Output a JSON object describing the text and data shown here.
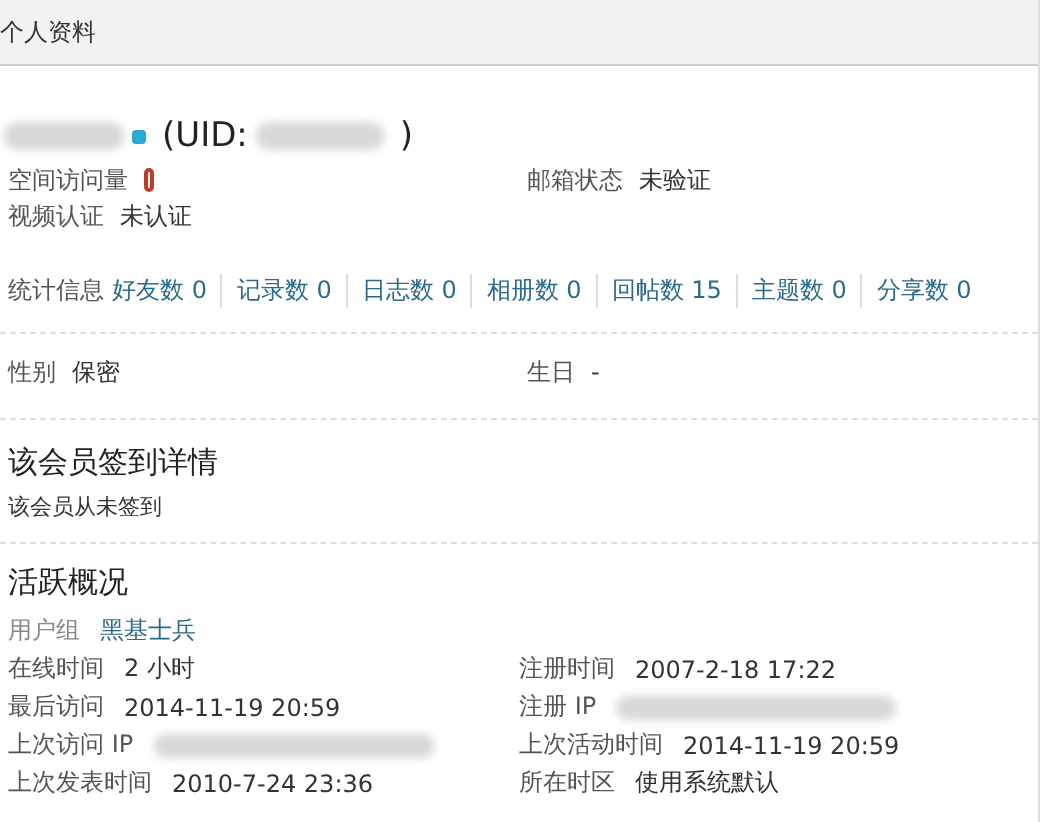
{
  "header": {
    "title": "个人资料"
  },
  "profile": {
    "uid_label": "(UID:",
    "uid_close": ")"
  },
  "info_rows": [
    {
      "left": {
        "label": "空间访问量"
      },
      "right": {
        "label": "邮箱状态",
        "value": "未验证"
      }
    },
    {
      "left": {
        "label": "视频认证",
        "value": "未认证"
      }
    }
  ],
  "stats": {
    "label": "统计信息",
    "items": [
      "好友数 0",
      "记录数 0",
      "日志数 0",
      "相册数 0",
      "回帖数 15",
      "主题数 0",
      "分享数 0"
    ]
  },
  "personal": [
    {
      "label": "性别",
      "value": "保密"
    },
    {
      "label": "生日",
      "value": "-"
    }
  ],
  "checkin": {
    "title": "该会员签到详情",
    "text": "该会员从未签到"
  },
  "activity": {
    "title": "活跃概况",
    "group_label": "用户组",
    "group_value": "黑基士兵",
    "left": [
      {
        "label": "在线时间",
        "value": "2 小时"
      },
      {
        "label": "最后访问",
        "value": "2014-11-19 20:59"
      },
      {
        "label": "上次访问 IP",
        "blurred": true
      },
      {
        "label": "上次发表时间",
        "value": "2010-7-24 23:36"
      }
    ],
    "right": [
      {
        "label": "注册时间",
        "value": "2007-2-18 17:22"
      },
      {
        "label": "注册 IP",
        "blurred": true
      },
      {
        "label": "上次活动时间",
        "value": "2014-11-19 20:59"
      },
      {
        "label": "所在时区",
        "value": "使用系统默认"
      }
    ]
  }
}
